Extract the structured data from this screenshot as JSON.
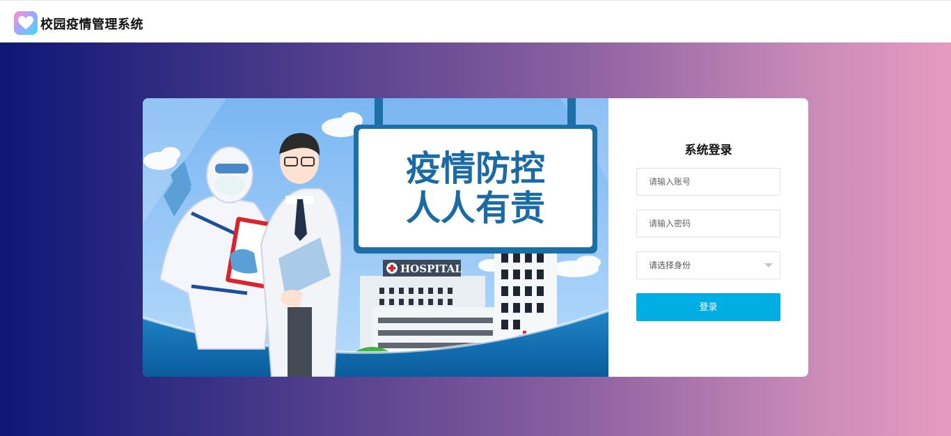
{
  "app": {
    "title": "校园疫情管理系统",
    "logo_icon": "heart-logo-icon"
  },
  "banner": {
    "sign_line1": "疫情防控",
    "sign_line2": "人人有责",
    "hospital_label": "HOSPITAL"
  },
  "login": {
    "title": "系统登录",
    "account_placeholder": "请输入账号",
    "password_placeholder": "请输入密码",
    "role_placeholder": "请选择身份",
    "submit_label": "登录"
  },
  "colors": {
    "accent": "#00aee3",
    "gradient_start": "#0d1776",
    "gradient_end": "#e69bc0"
  }
}
